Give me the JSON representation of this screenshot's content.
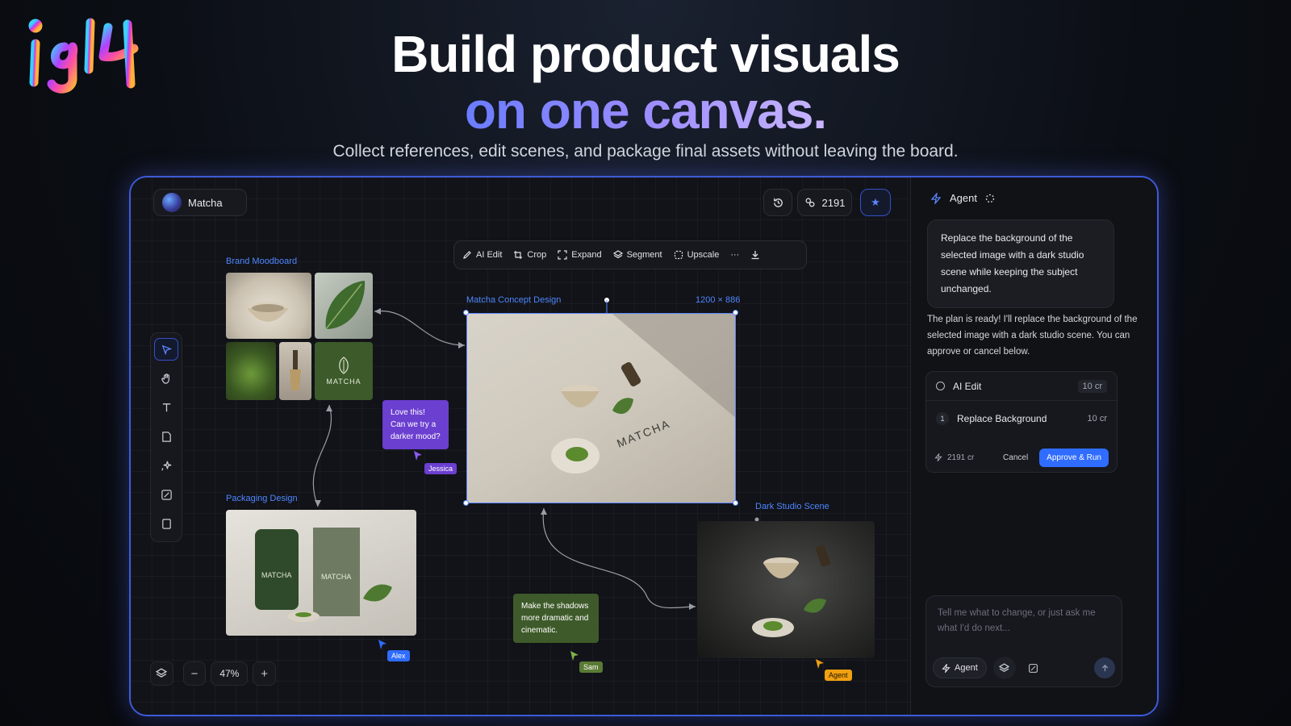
{
  "hero": {
    "title_line1": "Build product visuals",
    "title_line2": "on one canvas.",
    "subtitle": "Collect references, edit scenes, and package final assets without leaving the board."
  },
  "project": {
    "name": "Matcha"
  },
  "header": {
    "credits": "2191"
  },
  "toolbar": {
    "items": [
      "AI Edit",
      "Crop",
      "Expand",
      "Segment",
      "Upscale"
    ]
  },
  "canvas": {
    "zoom": "47%",
    "frames": {
      "moodboard": "Brand Moodboard",
      "concept": "Matcha Concept Design",
      "concept_size": "1200 × 886",
      "packaging": "Packaging Design",
      "dark_scene": "Dark Studio Scene"
    },
    "moodboard_tile_text": "MATCHA",
    "notes": {
      "jessica_note": "Love this! Can we try a darker mood?",
      "sam_note": "Make the shadows more dramatic and cinematic."
    },
    "cursors": {
      "jessica": "Jessica",
      "alex": "Alex",
      "sam": "Sam",
      "agent": "Agent"
    }
  },
  "agent_panel": {
    "title": "Agent",
    "user_message": "Replace the background of the selected image with a dark studio scene while keeping the subject unchanged.",
    "reply": "The plan is ready! I'll replace the background of the selected image with a dark studio scene. You can approve or cancel below.",
    "plan": {
      "title": "AI Edit",
      "title_cost": "10 cr",
      "step_num": "1",
      "step_label": "Replace Background",
      "step_cost": "10 cr",
      "balance": "2191 cr",
      "cancel": "Cancel",
      "approve": "Approve & Run"
    },
    "chat": {
      "placeholder": "Tell me what to change, or just ask me what I'd do next...",
      "agent_button": "Agent"
    }
  },
  "colors": {
    "accent": "#2f6cff",
    "frame_label": "#4f86ff",
    "note_purple": "#6b3fd0",
    "note_green": "#3e5a2a",
    "tag_orange": "#f0a010"
  }
}
